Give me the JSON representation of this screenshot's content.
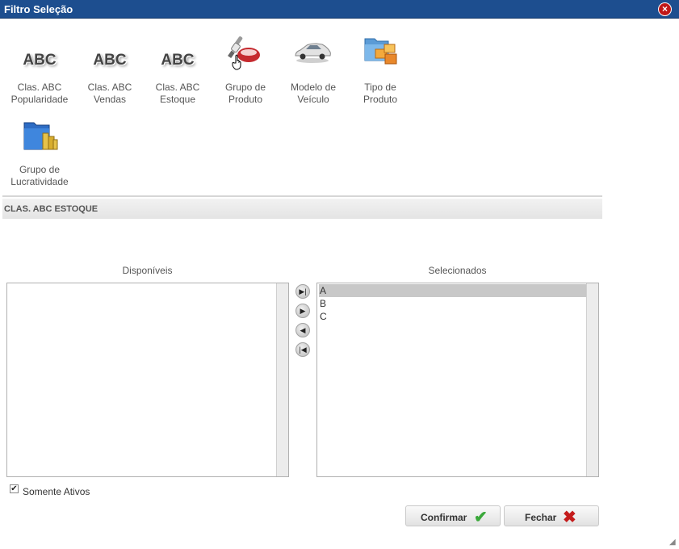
{
  "dialog": {
    "title": "Filtro Seleção"
  },
  "icons": [
    {
      "name": "abc-popularidade",
      "icon": "abc-text-icon",
      "art": "ABC",
      "line1": "Clas. ABC",
      "line2": "Popularidade"
    },
    {
      "name": "abc-vendas",
      "icon": "abc-text-icon",
      "art": "ABC",
      "line1": "Clas. ABC",
      "line2": "Vendas"
    },
    {
      "name": "abc-estoque",
      "icon": "abc-text-icon",
      "art": "ABC",
      "line1": "Clas. ABC",
      "line2": "Estoque"
    },
    {
      "name": "grupo-produto",
      "icon": "spark-plug-icon",
      "line1": "Grupo de",
      "line2": "Produto"
    },
    {
      "name": "modelo-veiculo",
      "icon": "car-icon",
      "line1": "Modelo de",
      "line2": "Veículo"
    },
    {
      "name": "tipo-produto",
      "icon": "folder-boxes-icon",
      "line1": "Tipo de",
      "line2": "Produto"
    },
    {
      "name": "grupo-lucratividade",
      "icon": "folder-coins-icon",
      "line1": "Grupo de",
      "line2": "Lucratividade"
    }
  ],
  "section": {
    "title": "CLAS. ABC ESTOQUE"
  },
  "lists": {
    "available": {
      "header": "Disponíveis",
      "items": []
    },
    "selected": {
      "header": "Selecionados",
      "items": [
        "A",
        "B",
        "C"
      ],
      "selected_index": 0
    }
  },
  "arrows": [
    {
      "name": "move-all-right",
      "icon": "double-right-icon",
      "glyph": "▶|"
    },
    {
      "name": "move-right",
      "icon": "right-icon",
      "glyph": "▶"
    },
    {
      "name": "move-left",
      "icon": "left-icon",
      "glyph": "◀"
    },
    {
      "name": "move-all-left",
      "icon": "double-left-icon",
      "glyph": "|◀"
    }
  ],
  "options": {
    "somente_ativos_label": "Somente Ativos",
    "somente_ativos_checked": true
  },
  "buttons": {
    "confirm": "Confirmar",
    "close": "Fechar"
  },
  "colors": {
    "titlebar": "#1d4e8f",
    "confirm_check": "#3aa83a",
    "close_x": "#c41b1b"
  }
}
